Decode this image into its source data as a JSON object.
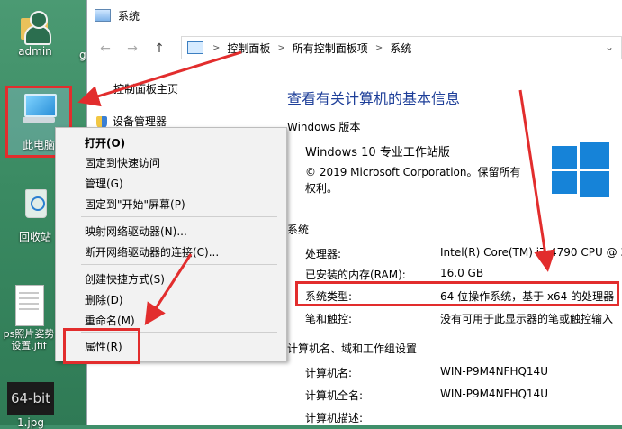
{
  "desktop": {
    "icons": [
      {
        "label": "admin"
      },
      {
        "label": "此电脑"
      },
      {
        "label": "回收站"
      },
      {
        "label": "ps照片姿势设置.jfif"
      },
      {
        "label": "64-bit",
        "caption": "1.jpg"
      }
    ],
    "partial_label": "g"
  },
  "window": {
    "title": "系统",
    "address": {
      "crumbs": [
        "控制面板",
        "所有控制面板项",
        "系统"
      ],
      "separator": ">",
      "dropdown": "⌄"
    },
    "nav": {
      "back": "←",
      "forward": "→",
      "up": "↑"
    },
    "left_pane": {
      "home_link": "控制面板主页",
      "device_manager": "设备管理器"
    },
    "main": {
      "heading": "查看有关计算机的基本信息",
      "windows_edition": {
        "section": "Windows 版本",
        "edition": "Windows 10 专业工作站版",
        "copyright_line1": "© 2019 Microsoft Corporation。保留所有",
        "copyright_line2": "权利。"
      },
      "system": {
        "section": "系统",
        "processor_label": "处理器:",
        "processor_value": "Intel(R) Core(TM) i7-4790 CPU @ 3",
        "ram_label": "已安装的内存(RAM):",
        "ram_value": "16.0 GB",
        "type_label": "系统类型:",
        "type_value": "64 位操作系统，基于 x64 的处理器",
        "pen_label": "笔和触控:",
        "pen_value": "没有可用于此显示器的笔或触控输入"
      },
      "computer": {
        "section": "计算机名、域和工作组设置",
        "name_label": "计算机名:",
        "name_value": "WIN-P9M4NFHQ14U",
        "fullname_label": "计算机全名:",
        "fullname_value": "WIN-P9M4NFHQ14U",
        "desc_label": "计算机描述:"
      }
    }
  },
  "context_menu": {
    "items": [
      {
        "label": "打开(O)"
      },
      {
        "label": "固定到快速访问"
      },
      {
        "label": "管理(G)"
      },
      {
        "label": "固定到\"开始\"屏幕(P)"
      },
      {
        "label": "映射网络驱动器(N)..."
      },
      {
        "label": "断开网络驱动器的连接(C)..."
      },
      {
        "label": "创建快捷方式(S)"
      },
      {
        "label": "删除(D)"
      },
      {
        "label": "重命名(M)"
      },
      {
        "label": "属性(R)"
      }
    ]
  },
  "colors": {
    "annotation_red": "#e22d2d",
    "heading_blue": "#1e3f99",
    "windows_blue": "#1683d8"
  }
}
